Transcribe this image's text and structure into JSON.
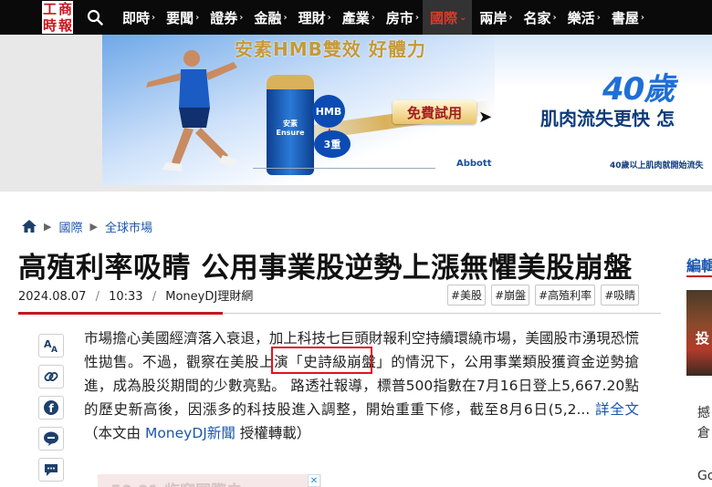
{
  "logo": {
    "chars": [
      "工",
      "商",
      "時",
      "報"
    ],
    "brand_color": "#c4171d"
  },
  "nav": {
    "search_icon": "search-icon",
    "items": [
      {
        "label": "即時",
        "active": false
      },
      {
        "label": "要聞",
        "active": false
      },
      {
        "label": "證券",
        "active": false
      },
      {
        "label": "金融",
        "active": false
      },
      {
        "label": "理財",
        "active": false
      },
      {
        "label": "產業",
        "active": false
      },
      {
        "label": "房市",
        "active": false
      },
      {
        "label": "國際",
        "active": true
      },
      {
        "label": "兩岸",
        "active": false
      },
      {
        "label": "名家",
        "active": false
      },
      {
        "label": "樂活",
        "active": false
      },
      {
        "label": "書屋",
        "active": false
      }
    ],
    "arrow": "›",
    "active_arrow": "⌄"
  },
  "ad": {
    "headline": "安素HMB雙效 好體力",
    "free_trial": "免費試用",
    "hmb": "HMB",
    "three": "3重",
    "bottle_label": "安素 Ensure",
    "brand": "Abbott",
    "age_title": "40歲",
    "age_text": "肌肉流失更快 怎",
    "small_note": "40歲以上肌肉就開始流失"
  },
  "breadcrumb": {
    "items": [
      "國際",
      "全球市場"
    ]
  },
  "article": {
    "title": "高殖利率吸睛 公用事業股逆勢上漲無懼美股崩盤",
    "date": "2024.08.07",
    "time": "10:33",
    "source": "MoneyDJ理財網",
    "tags": [
      "#美股",
      "#崩盤",
      "#高殖利率",
      "#吸睛"
    ],
    "body_part1": "市場擔心美國經濟落入衰退，加上科技七巨頭財報利空持續環繞市場，美國股市湧現恐慌性拋售。不過，觀察在美股上演「史詩級崩盤」的情況下，公用事業類股獲資金逆勢搶進，成為股災期間的少數亮點。 路透社報導，標普500指數在7月16日登上5,667.20點的歷史新高後，因漲多的科技股進入調整，開始重重下修，截至8月6日(5,2...",
    "read_more": "詳全文",
    "body_part2": "（本文由",
    "source_link": "MoneyDJ新聞",
    "body_part3": "授權轉載）"
  },
  "share": {
    "icons": [
      "font-size-icon",
      "link-icon",
      "facebook-icon",
      "line-icon",
      "comment-icon"
    ]
  },
  "sidebar": {
    "heading": "編輯",
    "image_text": "投",
    "text1": "撼倉",
    "text2": "Go"
  },
  "bottom_ad": {
    "text": "50 01 临窗国際去"
  }
}
